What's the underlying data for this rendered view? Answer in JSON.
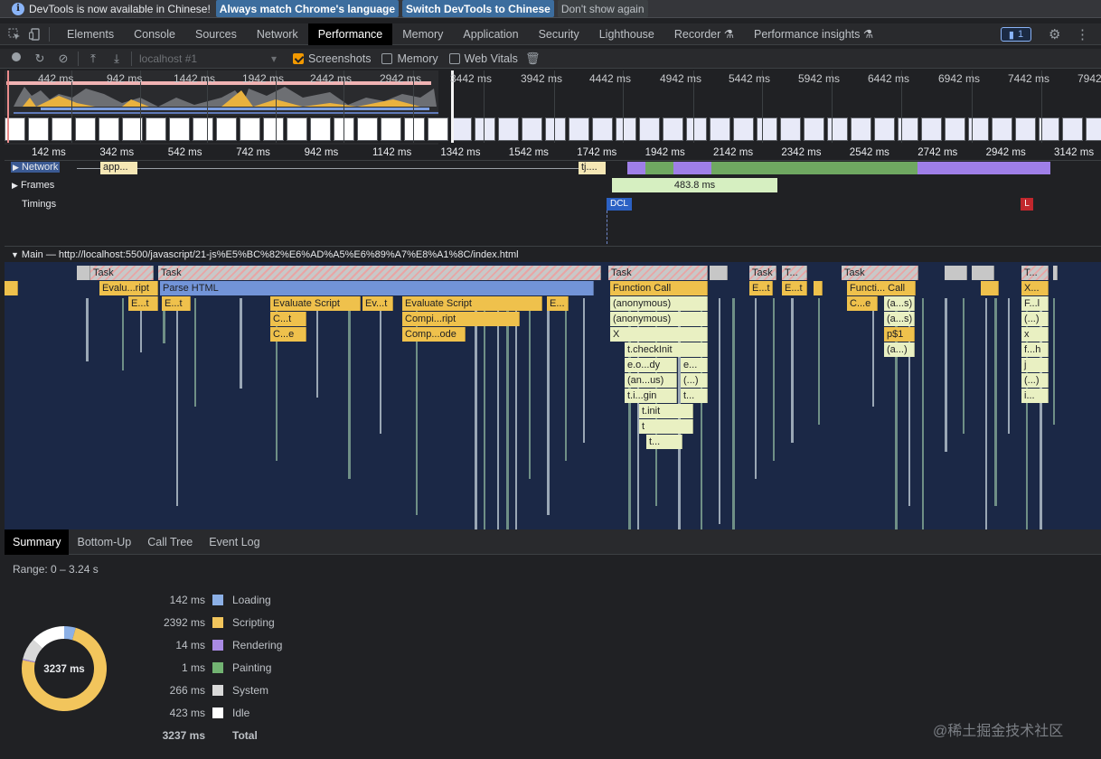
{
  "infobar": {
    "message": "DevTools is now available in Chinese!",
    "match_button": "Always match Chrome's language",
    "switch_button": "Switch DevTools to Chinese",
    "dismiss_button": "Don't show again"
  },
  "tabs": [
    {
      "label": "Elements"
    },
    {
      "label": "Console"
    },
    {
      "label": "Sources"
    },
    {
      "label": "Network"
    },
    {
      "label": "Performance",
      "active": true
    },
    {
      "label": "Memory"
    },
    {
      "label": "Application"
    },
    {
      "label": "Security"
    },
    {
      "label": "Lighthouse"
    },
    {
      "label": "Recorder ⚗"
    },
    {
      "label": "Performance insights ⚗"
    }
  ],
  "issues_count": "1",
  "toolbar": {
    "target_placeholder": "localhost #1",
    "screenshots_label": "Screenshots",
    "screenshots_checked": true,
    "memory_label": "Memory",
    "memory_checked": false,
    "webvitals_label": "Web Vitals",
    "webvitals_checked": false
  },
  "overview_ticks": [
    "442 ms",
    "942 ms",
    "1442 ms",
    "1942 ms",
    "2442 ms",
    "2942 ms",
    "3442 ms",
    "3942 ms",
    "4442 ms",
    "4942 ms",
    "5442 ms",
    "5942 ms",
    "6442 ms",
    "6942 ms",
    "7442 ms",
    "7942"
  ],
  "ruler_ticks": [
    "142 ms",
    "342 ms",
    "542 ms",
    "742 ms",
    "942 ms",
    "1142 ms",
    "1342 ms",
    "1542 ms",
    "1742 ms",
    "1942 ms",
    "2142 ms",
    "2342 ms",
    "2542 ms",
    "2742 ms",
    "2942 ms",
    "3142 ms"
  ],
  "tracks": {
    "network_label": "Network",
    "network_items": [
      "app...",
      "tj...."
    ],
    "frames_label": "Frames",
    "frame_duration": "483.8 ms",
    "timings_label": "Timings",
    "dcl": "DCL",
    "load": "L"
  },
  "main_header": "Main — http://localhost:5500/javascript/21-js%E5%BC%82%E6%AD%A5%E6%89%A7%E8%A1%8C/index.html",
  "flame": {
    "tasks": [
      "Task",
      "Task",
      "Task",
      "Task",
      "T...",
      "Task",
      "T..."
    ],
    "row1": [
      "Evalu...ript",
      "Parse HTML",
      "Function Call",
      "E...t",
      "E...t",
      "Functi... Call",
      "X..."
    ],
    "row2": [
      "E...t",
      "E...t",
      "Evaluate Script",
      "Ev...t",
      "Evaluate Script",
      "E...",
      "(anonymous)",
      "C...e",
      "(a...s)",
      "F...l"
    ],
    "row3": [
      "C...t",
      "Compi...ript",
      "(anonymous)",
      "(a...s)",
      "(...)"
    ],
    "row4": [
      "C...e",
      "Comp...ode",
      "X",
      "p$1",
      "x"
    ],
    "row5": [
      "t.checkInit",
      "(a...)",
      "f...h"
    ],
    "row6": [
      "e.o...dy",
      "e...",
      "j"
    ],
    "row7": [
      "(an...us)",
      "(...)",
      "(...)"
    ],
    "row8": [
      "t.i...gin",
      "t...",
      "i..."
    ],
    "row9": [
      "t.init"
    ],
    "row10": [
      "t"
    ],
    "row11": [
      "t..."
    ]
  },
  "bottom_tabs": [
    "Summary",
    "Bottom-Up",
    "Call Tree",
    "Event Log"
  ],
  "summary": {
    "range": "Range: 0 – 3.24 s",
    "total_center": "3237 ms",
    "rows": [
      {
        "value": "142 ms",
        "label": "Loading",
        "color": "#8cb0e6"
      },
      {
        "value": "2392 ms",
        "label": "Scripting",
        "color": "#f2c55c"
      },
      {
        "value": "14 ms",
        "label": "Rendering",
        "color": "#a98ae4"
      },
      {
        "value": "1 ms",
        "label": "Painting",
        "color": "#72b372"
      },
      {
        "value": "266 ms",
        "label": "System",
        "color": "#d9d9d9"
      },
      {
        "value": "423 ms",
        "label": "Idle",
        "color": "#ffffff"
      }
    ],
    "total_value": "3237 ms",
    "total_label": "Total"
  },
  "watermark": "@稀土掘金技术社区"
}
